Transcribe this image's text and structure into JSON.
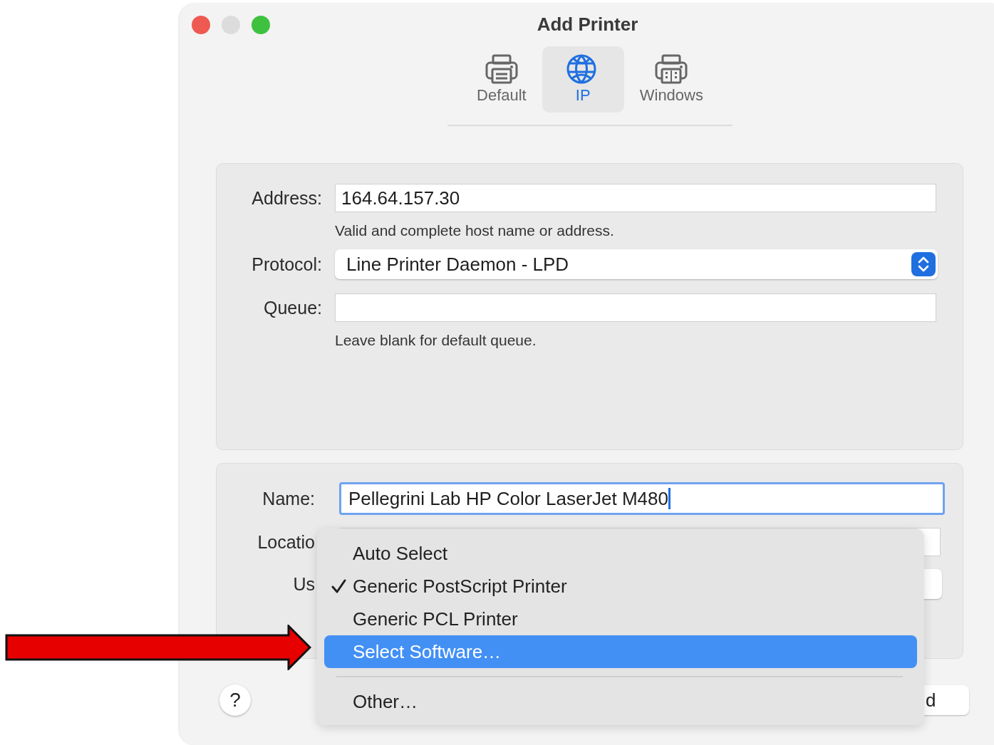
{
  "window": {
    "title": "Add Printer"
  },
  "toolbar": [
    {
      "label": "Default",
      "kind": "printer",
      "selected": false
    },
    {
      "label": "IP",
      "kind": "globe",
      "selected": true
    },
    {
      "label": "Windows",
      "kind": "printer-grid",
      "selected": false
    }
  ],
  "address_section": {
    "fields": [
      {
        "label": "Address:",
        "kind": "text",
        "value": "164.64.157.30",
        "hint": "Valid and complete host name or address."
      },
      {
        "label": "Protocol:",
        "kind": "popup",
        "value": "Line Printer Daemon - LPD"
      },
      {
        "label": "Queue:",
        "kind": "text",
        "hint": "Leave blank for default queue."
      }
    ]
  },
  "details_section": {
    "fields": [
      {
        "label": "Name:",
        "kind": "text",
        "value": "Pellegrini Lab HP Color LaserJet M480",
        "focused": true
      },
      {
        "label": "Locatio",
        "kind": "text",
        "focused": false
      },
      {
        "label": "Us",
        "kind": "popup"
      }
    ]
  },
  "menu": {
    "items": [
      {
        "kind": "item",
        "label": "Auto Select",
        "checked": false,
        "selected": false
      },
      {
        "kind": "item",
        "label": "Generic PostScript Printer",
        "checked": true,
        "selected": false
      },
      {
        "kind": "item",
        "label": "Generic PCL Printer",
        "checked": false,
        "selected": false
      },
      {
        "kind": "item",
        "label": "Select Software…",
        "checked": false,
        "selected": true
      },
      {
        "kind": "separator"
      },
      {
        "kind": "item",
        "label": "Other…",
        "checked": false,
        "selected": false
      }
    ]
  },
  "help_button": {
    "label": "?"
  },
  "add_button": {
    "label": "d"
  }
}
